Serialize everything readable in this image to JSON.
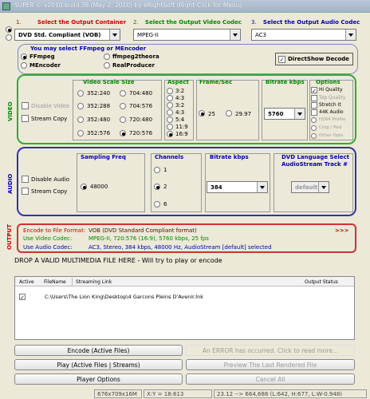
{
  "titlebar": {
    "text": "SUPER © v2010.build.38 (May 2, 2010) by eRightSoft        (Right-Click for Menu)"
  },
  "sections": {
    "container": {
      "num": "1.",
      "title": "Select the Output Container",
      "value": "DVD   Std. Compliant (VOB)"
    },
    "video_codec": {
      "num": "2.",
      "title": "Select the Output Video Codec",
      "value": "MPEG-II"
    },
    "audio_codec": {
      "num": "3.",
      "title": "Select the Output Audio Codec",
      "value": "AC3"
    }
  },
  "encoder": {
    "title": "You may select FFmpeg or MEncoder",
    "options": [
      "FFmpeg",
      "ffmpeg2theora",
      "MEncoder",
      "RealProducer"
    ],
    "selected": "FFmpeg",
    "directshow_label": "DirectShow Decode",
    "directshow_checked": true
  },
  "video": {
    "side_label": "VIDEO",
    "disable_label": "Disable Video",
    "stream_copy_label": "Stream Copy",
    "scale": {
      "title": "Video Scale Size",
      "options": [
        "352:240",
        "704:480",
        "352:288",
        "704:576",
        "352:480",
        "720:480",
        "352:576",
        "720:576"
      ],
      "selected": "720:576"
    },
    "aspect": {
      "title": "Aspect",
      "options": [
        "3:2",
        "4:3",
        "5:4",
        "11:9",
        "16:9"
      ],
      "selected": "16:9"
    },
    "framerate": {
      "title": "Frame/Sec",
      "options": [
        "25",
        "29.97"
      ],
      "selected": "25"
    },
    "bitrate": {
      "title": "Bitrate  kbps",
      "value": "5760"
    },
    "options": {
      "title": "Options",
      "items": [
        {
          "label": "Hi Quality",
          "checked": true,
          "enabled": true
        },
        {
          "label": "Top Quality",
          "checked": false,
          "enabled": false
        },
        {
          "label": "Stretch It",
          "checked": false,
          "enabled": true
        },
        {
          "label": "44K Audio",
          "checked": false,
          "enabled": true
        }
      ],
      "radios": [
        {
          "label": "H264 Profile",
          "selected": false
        },
        {
          "label": "Crop / Pad",
          "selected": false
        },
        {
          "label": "Other Opts",
          "selected": false
        }
      ]
    }
  },
  "audio": {
    "side_label": "AUDIO",
    "disable_label": "Disable Audio",
    "stream_copy_label": "Stream Copy",
    "sampling": {
      "title": "Sampling Freq",
      "value": "48000"
    },
    "channels": {
      "title": "Channels",
      "options": [
        "1",
        "2",
        "6"
      ],
      "selected": "2"
    },
    "bitrate": {
      "title": "Bitrate  kbps",
      "value": "384"
    },
    "dvd_lang": {
      "title": "DVD Language Select",
      "subtitle": "AudioStream  Track #",
      "value": "default"
    }
  },
  "output": {
    "side_label": "OUTPUT",
    "lines": [
      {
        "key": "Encode to File Format:",
        "value": "VOB (DVD Standard Compliant format)"
      },
      {
        "key": "Use Video Codec:",
        "value": "MPEG-II,  720:576 (16:9),  5760 kbps,  25 fps"
      },
      {
        "key": "Use Audio Codec:",
        "value": "AC3,  Stereo,  384 kbps,  48000 Hz,  AudioStream [default] selected"
      }
    ],
    "more": ">>>"
  },
  "drop_text": "DROP A VALID MULTIMEDIA FILE HERE - Will try to play or encode",
  "file_table": {
    "columns": [
      "Active",
      "FileName",
      "Streaming Link",
      "Output Status"
    ],
    "rows": [
      {
        "active": true,
        "filename": "C:\\Users\\The Lion King\\Desktop\\4 Garcons Pleins D'Avenir.lnk",
        "status": ""
      }
    ]
  },
  "buttons": {
    "encode": "Encode (Active Files)",
    "play": "Play (Active Files | Streams)",
    "player_options": "Player Options",
    "error": "An ERROR has occurred. Click to read more...",
    "preview": "Preview The Last Rendered File",
    "cancel": "Cancel All"
  },
  "statusbar": {
    "cells": [
      "676x709x16M",
      "X:Y = 18:613",
      "23.12 --> 664,688 (L:642, H:677, L:W-0.948)"
    ]
  },
  "colors": {
    "red": "#cc0000",
    "green": "#008800",
    "blue": "#0000aa",
    "bg": "#ece9d8"
  }
}
